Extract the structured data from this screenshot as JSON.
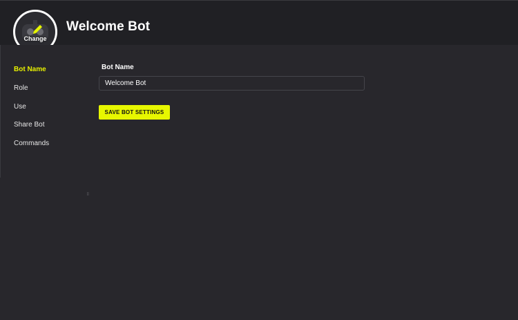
{
  "header": {
    "title": "Welcome Bot",
    "avatar_change_label": "Change",
    "avatar_icon": "bot-avatar-icon"
  },
  "sidebar": {
    "items": [
      {
        "label": "Bot Name",
        "active": true
      },
      {
        "label": "Role",
        "active": false
      },
      {
        "label": "Use",
        "active": false
      },
      {
        "label": "Share Bot",
        "active": false
      },
      {
        "label": "Commands",
        "active": false
      }
    ]
  },
  "form": {
    "bot_name_label": "Bot Name",
    "bot_name_value": "Welcome Bot",
    "save_button_label": "SAVE BOT SETTINGS"
  },
  "colors": {
    "accent": "#e7f700",
    "background": "#28272c",
    "header_background": "#202024"
  }
}
